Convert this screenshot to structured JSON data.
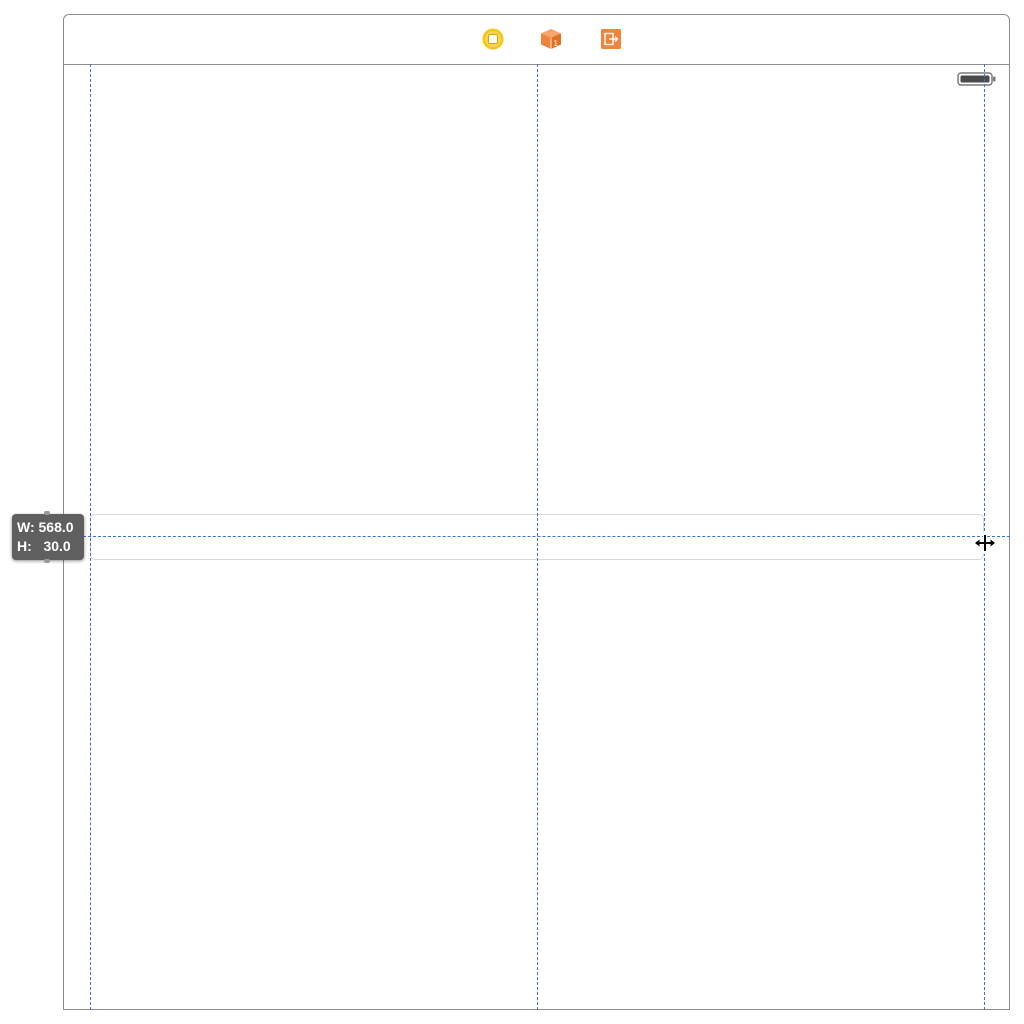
{
  "scene": {
    "dock_icons": [
      {
        "icon": "view-controller-icon",
        "color": "#f5c518"
      },
      {
        "icon": "first-responder-cube-icon",
        "color": "#f0843a"
      },
      {
        "icon": "exit-icon",
        "color": "#f0843a"
      }
    ],
    "status_bar": {
      "icon": "battery-icon"
    }
  },
  "size_tooltip": {
    "width_label": "W:",
    "width_value": "568.0",
    "height_label": "H:",
    "height_value": "30.0"
  },
  "colors": {
    "guide": "#3f6fd1",
    "tooltip_bg": "#5f5f5f",
    "border": "#8c8c8c"
  },
  "cursor": {
    "icon": "resize-horizontal-cursor-icon"
  }
}
